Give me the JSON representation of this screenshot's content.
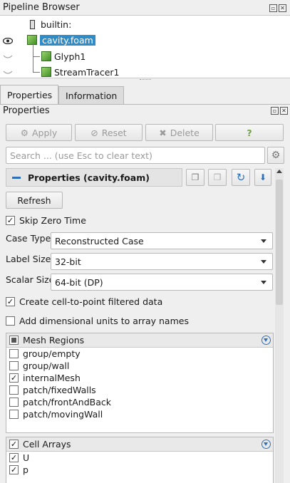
{
  "pipeline_browser": {
    "title": "Pipeline Browser",
    "items": [
      {
        "label": "builtin:"
      },
      {
        "label": "cavity.foam"
      },
      {
        "label": "Glyph1"
      },
      {
        "label": "StreamTracer1"
      }
    ]
  },
  "tabs": [
    {
      "label": "Properties"
    },
    {
      "label": "Information"
    }
  ],
  "properties_panel": {
    "title": "Properties",
    "buttons": {
      "apply": "Apply",
      "reset": "Reset",
      "delete": "Delete",
      "help": "?"
    },
    "search": {
      "placeholder": "Search ... (use Esc to clear text)"
    },
    "section_title": "Properties (cavity.foam)",
    "refresh": "Refresh",
    "skip_zero_time": {
      "label": "Skip Zero Time",
      "checked": true
    },
    "case_type": {
      "label": "Case Type",
      "value": "Reconstructed Case"
    },
    "label_size": {
      "label": "Label Size",
      "value": "32-bit"
    },
    "scalar_size": {
      "label": "Scalar Size",
      "value": "64-bit (DP)"
    },
    "create_cell_to_point": {
      "label": "Create cell-to-point filtered data",
      "checked": true
    },
    "add_dim_units": {
      "label": "Add dimensional units to array names",
      "checked": false
    },
    "mesh_regions": {
      "header": "Mesh Regions",
      "items": [
        {
          "label": "group/empty",
          "checked": false
        },
        {
          "label": "group/wall",
          "checked": false
        },
        {
          "label": "internalMesh",
          "checked": true
        },
        {
          "label": "patch/fixedWalls",
          "checked": false
        },
        {
          "label": "patch/frontAndBack",
          "checked": false
        },
        {
          "label": "patch/movingWall",
          "checked": false
        }
      ]
    },
    "cell_arrays": {
      "header": "Cell Arrays",
      "items": [
        {
          "label": "U",
          "checked": true
        },
        {
          "label": "p",
          "checked": true
        }
      ]
    }
  },
  "colors": {
    "selection": "#308cc6",
    "accent": "#2e6fb7"
  }
}
